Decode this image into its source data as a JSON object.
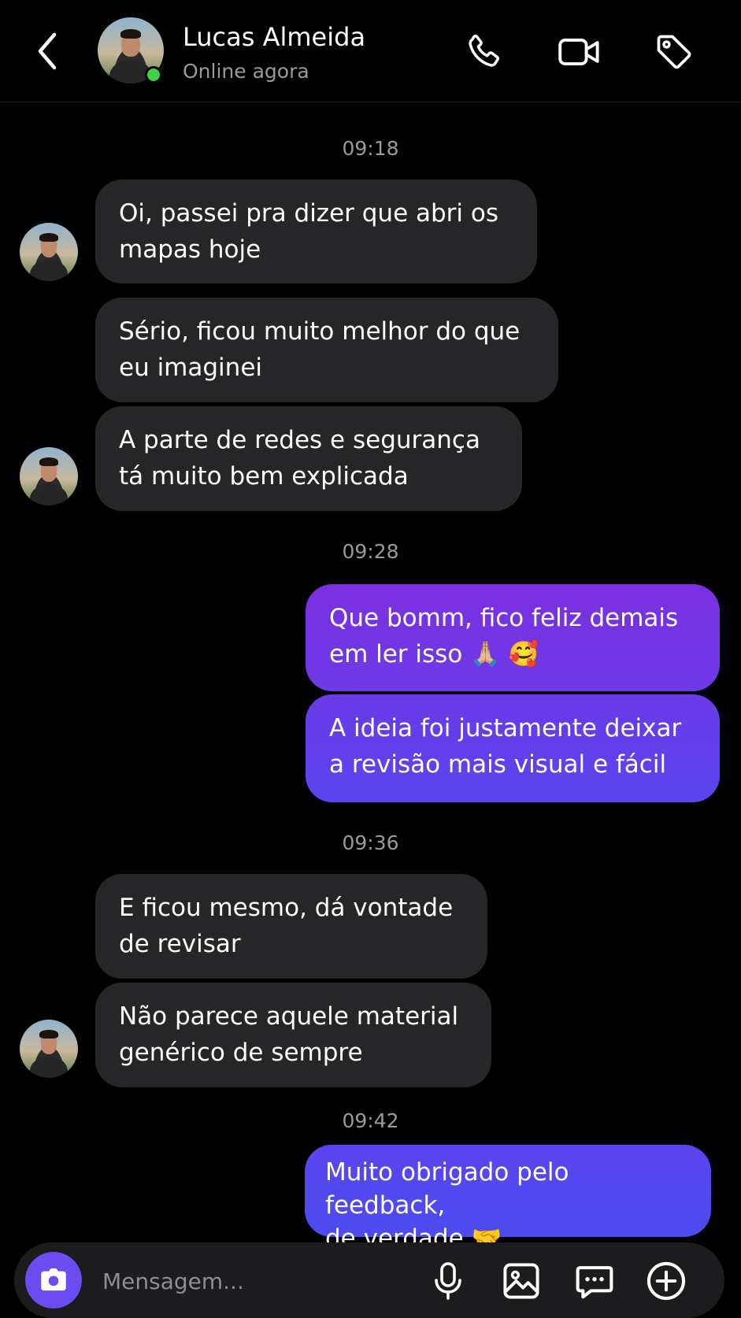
{
  "header": {
    "contact_name": "Lucas Almeida",
    "status": "Online agora",
    "online_color": "#3ed14e",
    "icons": [
      "chevron-left-icon",
      "phone-icon",
      "video-camera-icon",
      "tag-icon"
    ]
  },
  "messages": [
    {
      "type": "timestamp",
      "text": "09:18"
    },
    {
      "type": "incoming",
      "text": "Oi, passei pra dizer que abri os\nmapas hoje"
    },
    {
      "type": "incoming",
      "text": "Sério, ficou muito melhor do que\neu imaginei"
    },
    {
      "type": "incoming",
      "text": "A parte de redes e segurança\ntá muito bem explicada"
    },
    {
      "type": "timestamp",
      "text": "09:28"
    },
    {
      "type": "outgoing",
      "text": "Que bomm, fico feliz demais\nem ler isso 🙏🏼 🥰"
    },
    {
      "type": "outgoing",
      "text": "A ideia foi justamente deixar\na revisão mais visual e fácil"
    },
    {
      "type": "timestamp",
      "text": "09:36"
    },
    {
      "type": "incoming",
      "text": "E ficou mesmo, dá vontade\nde revisar"
    },
    {
      "type": "incoming",
      "text": "Não parece aquele material\ngenérico de sempre"
    },
    {
      "type": "timestamp",
      "text": "09:42"
    },
    {
      "type": "outgoing",
      "text": "Muito obrigado pelo feedback,\nde verdade 🤝"
    }
  ],
  "composer": {
    "placeholder": "Mensagem...",
    "accent": "#6c4bf0",
    "icons": [
      "camera-icon",
      "microphone-icon",
      "image-icon",
      "chat-bubble-icon",
      "plus-circle-icon"
    ]
  },
  "colors": {
    "incoming_bubble": "#262628",
    "outgoing_gradient_top": "#7b2fe0",
    "outgoing_gradient_bottom": "#5048ee"
  }
}
